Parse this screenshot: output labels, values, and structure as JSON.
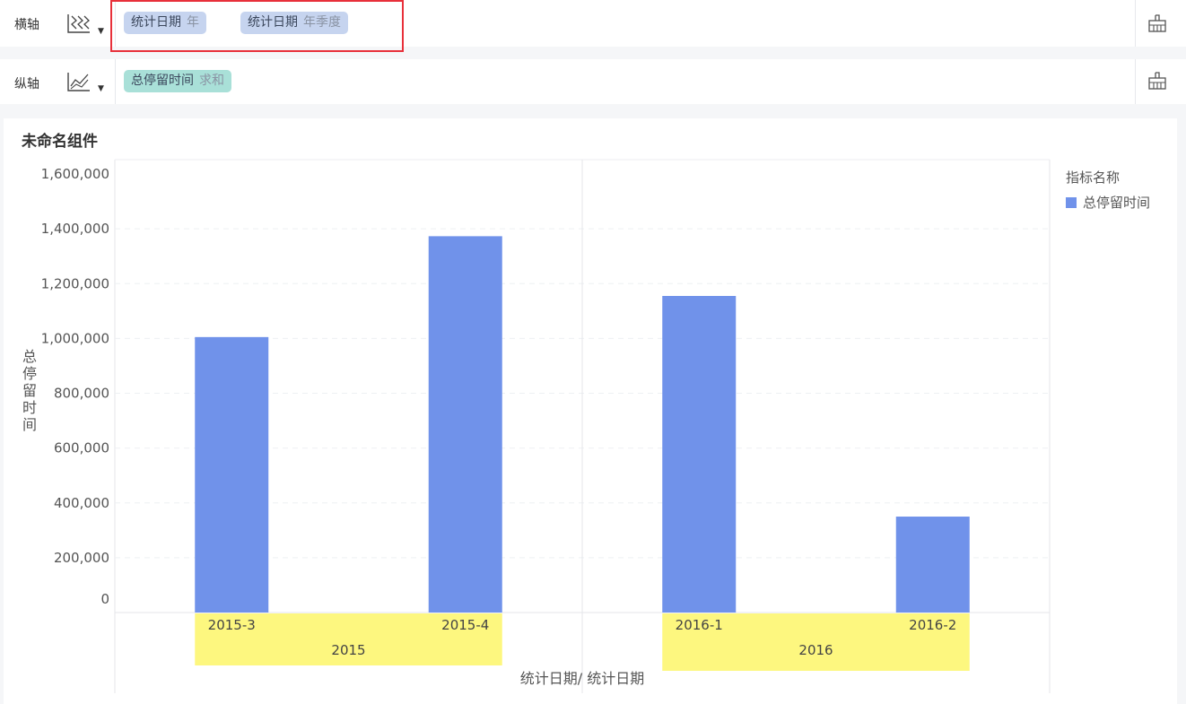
{
  "xaxis_bar": {
    "label": "横轴",
    "chart_type_icon": "dimension-axis-icon",
    "fields": [
      {
        "name": "统计日期",
        "granularity": "年"
      },
      {
        "name": "统计日期",
        "granularity": "年季度"
      }
    ],
    "setting_icon": "axis-setting-icon"
  },
  "yaxis_bar": {
    "label": "纵轴",
    "chart_type_icon": "line-chart-icon",
    "fields": [
      {
        "name": "总停留时间",
        "aggregation": "求和"
      }
    ],
    "setting_icon": "axis-setting-icon"
  },
  "component": {
    "title": "未命名组件",
    "legend": {
      "title": "指标名称",
      "items": [
        {
          "name": "总停留时间",
          "color": "#7092ea"
        }
      ]
    }
  },
  "chart_data": {
    "type": "bar",
    "categories": [
      "2015-3",
      "2015-4",
      "2016-1",
      "2016-2"
    ],
    "groups": [
      {
        "label": "2015",
        "categories": [
          "2015-3",
          "2015-4"
        ]
      },
      {
        "label": "2016",
        "categories": [
          "2016-1",
          "2016-2"
        ]
      }
    ],
    "series": [
      {
        "name": "总停留时间",
        "values": [
          1005000,
          1373000,
          1155000,
          350000
        ]
      }
    ],
    "ylabel": "总停留时间",
    "xlabel": "统计日期/ 统计日期",
    "ylim": [
      0,
      1600000
    ],
    "yticks": [
      "0",
      "200,000",
      "400,000",
      "600,000",
      "800,000",
      "1,000,000",
      "1,200,000",
      "1,400,000",
      "1,600,000"
    ],
    "bar_color": "#7092ea",
    "group_highlight_color": "#fdf77f",
    "grid": true
  }
}
